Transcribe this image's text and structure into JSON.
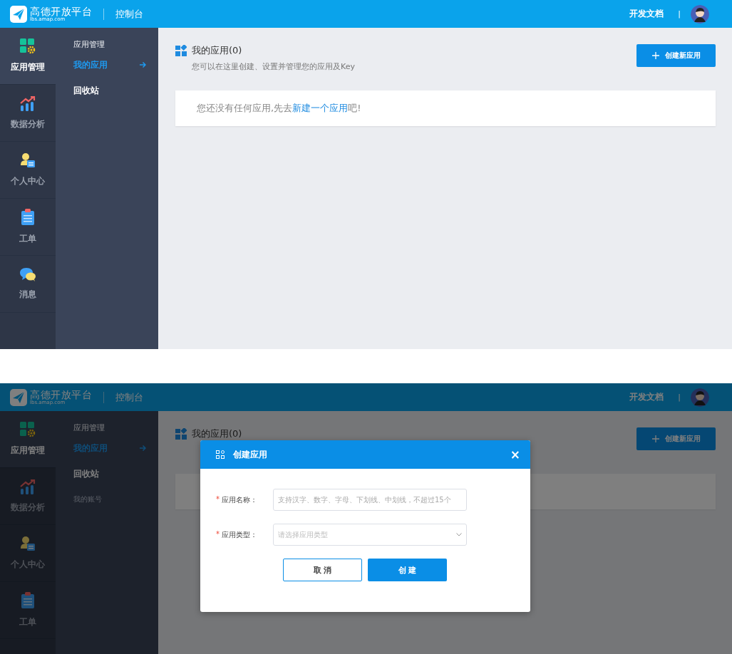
{
  "screens": [
    {
      "header": {
        "logo_title": "高德开放平台",
        "logo_url": "lbs.amap.com",
        "console": "控制台",
        "docs_link": "开发文档",
        "separator": "|"
      },
      "sidebar": {
        "items": [
          {
            "label": "应用管理",
            "kind": "apps",
            "selected": true
          },
          {
            "label": "数据分析",
            "kind": "chart",
            "selected": false
          },
          {
            "label": "个人中心",
            "kind": "user",
            "selected": false
          },
          {
            "label": "工单",
            "kind": "clipboard",
            "selected": false
          },
          {
            "label": "消息",
            "kind": "chat",
            "selected": false
          }
        ]
      },
      "subnav": {
        "heading": "应用管理",
        "items": [
          {
            "label": "我的应用",
            "selected": true,
            "disabled": false
          },
          {
            "label": "回收站",
            "selected": false,
            "disabled": false
          }
        ]
      },
      "main": {
        "title": "我的应用(0)",
        "subtitle": "您可以在这里创建、设置并管理您的应用及Key",
        "create_button": "创建新应用",
        "empty_before": "您还没有任何应用,先去",
        "empty_link": "新建一个应用",
        "empty_after": "吧!"
      }
    },
    {
      "header": {
        "logo_title": "高德开放平台",
        "logo_url": "lbs.amap.com",
        "console": "控制台",
        "docs_link": "开发文档",
        "separator": "|"
      },
      "sidebar": {
        "items": [
          {
            "label": "应用管理",
            "kind": "apps",
            "selected": true
          },
          {
            "label": "数据分析",
            "kind": "chart",
            "selected": false
          },
          {
            "label": "个人中心",
            "kind": "user",
            "selected": false
          },
          {
            "label": "工单",
            "kind": "clipboard",
            "selected": false
          }
        ]
      },
      "subnav": {
        "heading": "应用管理",
        "items": [
          {
            "label": "我的应用",
            "selected": true,
            "disabled": false
          },
          {
            "label": "回收站",
            "selected": false,
            "disabled": false
          },
          {
            "label": "我的账号",
            "selected": false,
            "disabled": true
          }
        ]
      },
      "main": {
        "title": "我的应用(0)",
        "create_button": "创建新应用"
      },
      "modal": {
        "title": "创建应用",
        "close": "×",
        "fields": [
          {
            "kind": "text",
            "label": "应用名称：",
            "required_mark": "*",
            "placeholder": "支持汉字、数字、字母、下划线、中划线，不超过15个"
          },
          {
            "kind": "select",
            "label": "应用类型：",
            "required_mark": "*",
            "placeholder": "请选择应用类型"
          }
        ],
        "cancel_button": "取 消",
        "submit_button": "创 建"
      }
    }
  ]
}
